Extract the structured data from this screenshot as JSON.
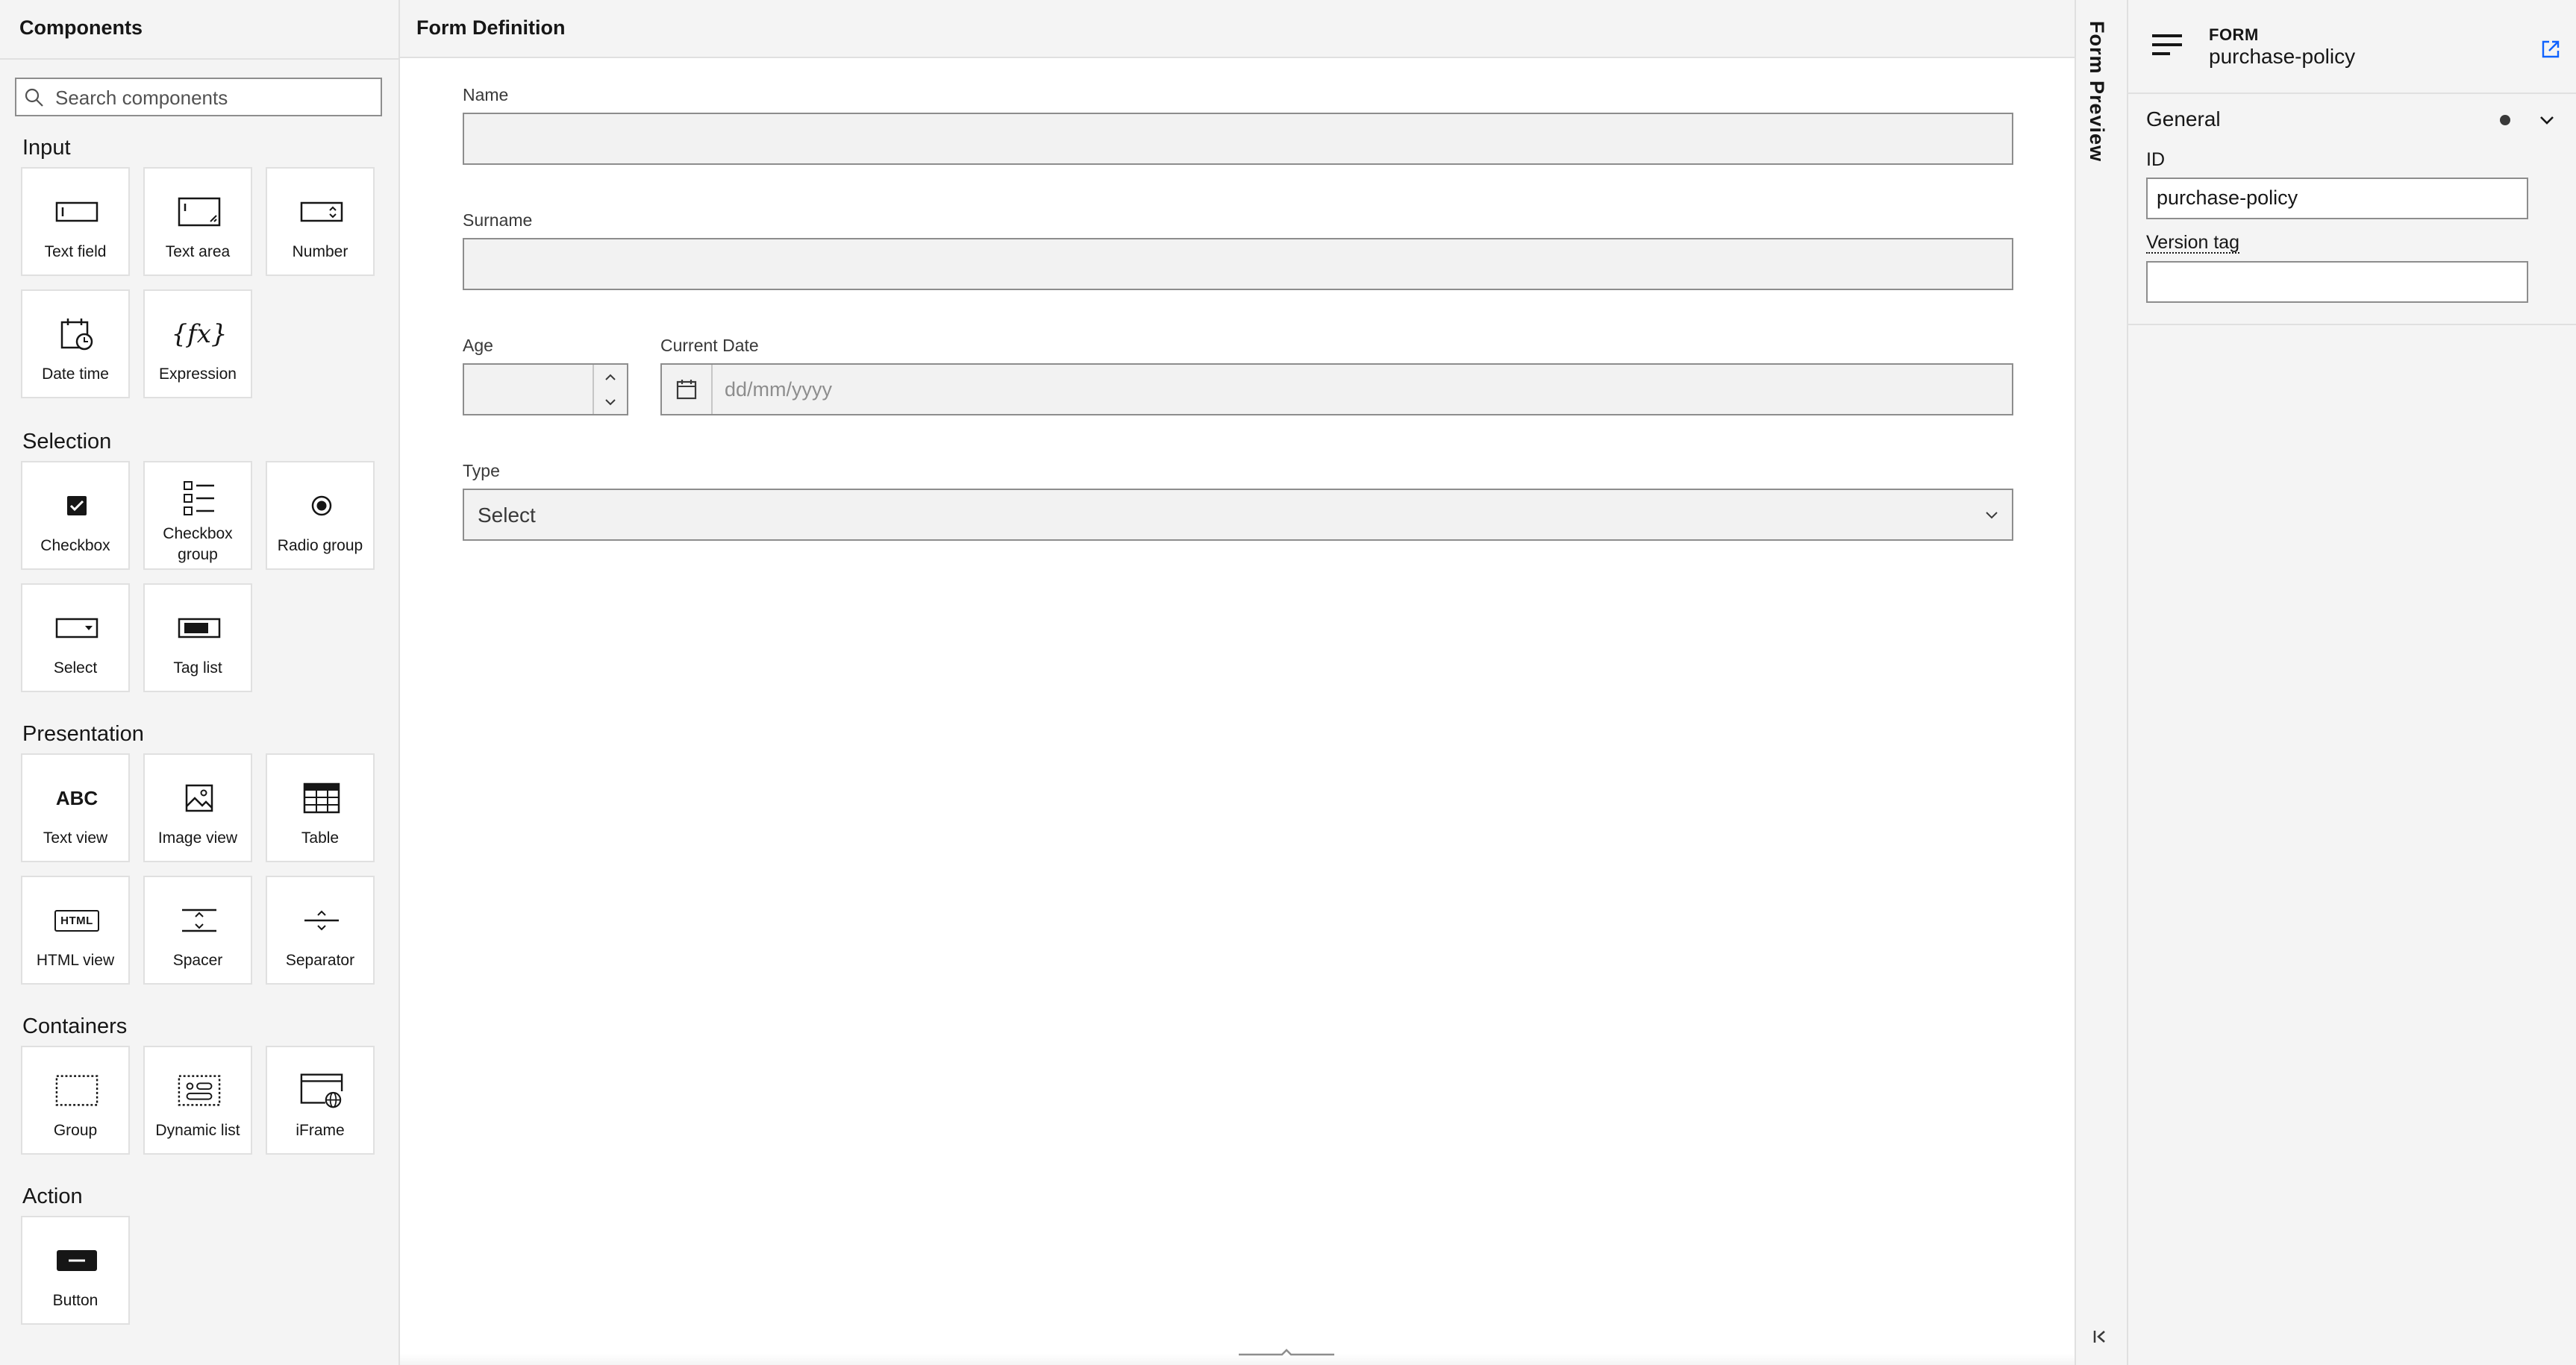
{
  "palette": {
    "title": "Components",
    "search_placeholder": "Search components",
    "groups": [
      {
        "title": "Input",
        "items": [
          {
            "label": "Text field",
            "icon": "text-field-icon"
          },
          {
            "label": "Text area",
            "icon": "text-area-icon"
          },
          {
            "label": "Number",
            "icon": "number-icon"
          },
          {
            "label": "Date time",
            "icon": "date-time-icon"
          },
          {
            "label": "Expression",
            "icon": "expression-icon",
            "glyph": "{fx}"
          }
        ]
      },
      {
        "title": "Selection",
        "items": [
          {
            "label": "Checkbox",
            "icon": "checkbox-icon"
          },
          {
            "label": "Checkbox group",
            "icon": "checkbox-group-icon"
          },
          {
            "label": "Radio group",
            "icon": "radio-group-icon"
          },
          {
            "label": "Select",
            "icon": "select-icon"
          },
          {
            "label": "Tag list",
            "icon": "tag-list-icon"
          }
        ]
      },
      {
        "title": "Presentation",
        "items": [
          {
            "label": "Text view",
            "icon": "text-view-icon",
            "glyph": "ABC"
          },
          {
            "label": "Image view",
            "icon": "image-view-icon"
          },
          {
            "label": "Table",
            "icon": "table-icon"
          },
          {
            "label": "HTML view",
            "icon": "html-view-icon",
            "glyph": "HTML"
          },
          {
            "label": "Spacer",
            "icon": "spacer-icon"
          },
          {
            "label": "Separator",
            "icon": "separator-icon"
          }
        ]
      },
      {
        "title": "Containers",
        "items": [
          {
            "label": "Group",
            "icon": "group-icon"
          },
          {
            "label": "Dynamic list",
            "icon": "dynamic-list-icon"
          },
          {
            "label": "iFrame",
            "icon": "iframe-icon"
          }
        ]
      },
      {
        "title": "Action",
        "items": [
          {
            "label": "Button",
            "icon": "button-icon"
          }
        ]
      }
    ]
  },
  "editor": {
    "title": "Form Definition",
    "fields": {
      "name_label": "Name",
      "surname_label": "Surname",
      "age_label": "Age",
      "current_date_label": "Current Date",
      "current_date_placeholder": "dd/mm/yyyy",
      "type_label": "Type",
      "type_value": "Select"
    }
  },
  "preview": {
    "label": "Form Preview"
  },
  "properties": {
    "type": "FORM",
    "name": "purchase-policy",
    "section_title": "General",
    "id_label": "ID",
    "id_value": "purchase-policy",
    "version_tag_label": "Version tag",
    "version_tag_value": ""
  },
  "colors": {
    "panel_bg": "#f4f4f4",
    "field_bg": "#f2f2f2",
    "border": "#8d8d8d",
    "accent_link": "#0f62fe"
  }
}
